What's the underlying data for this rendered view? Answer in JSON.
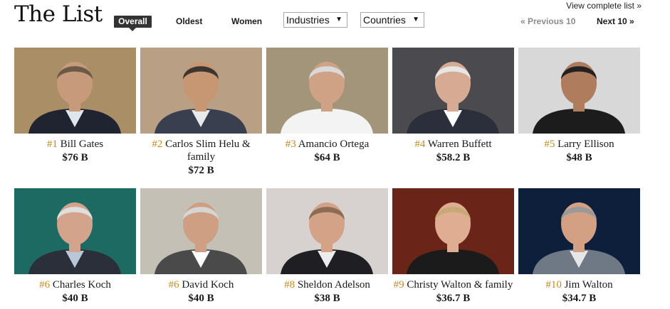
{
  "page": {
    "title": "The List",
    "view_complete": "View complete list »",
    "prev": "« Previous 10",
    "next": "Next 10 »"
  },
  "tabs": {
    "overall": "Overall",
    "oldest": "Oldest",
    "women": "Women"
  },
  "filters": {
    "industries": "Industries",
    "countries": "Countries"
  },
  "people": [
    {
      "rank": "#1",
      "name": "Bill Gates",
      "worth": "$76 B",
      "colors": {
        "bg": "#a98e66",
        "suit": "#1f2430",
        "skin": "#c89a7c",
        "hair": "#6b5a48",
        "shirt": "#dfe6ee"
      }
    },
    {
      "rank": "#2",
      "name": "Carlos Slim Helu & family",
      "worth": "$72 B",
      "colors": {
        "bg": "#b9a084",
        "suit": "#3a3f4f",
        "skin": "#c79774",
        "hair": "#3c3530",
        "shirt": "#e9e9ec"
      }
    },
    {
      "rank": "#3",
      "name": "Amancio Ortega",
      "worth": "$64 B",
      "colors": {
        "bg": "#a3957a",
        "suit": "#f3f3f3",
        "skin": "#cfa286",
        "hair": "#d9d9d9",
        "shirt": "#f3f3f3"
      }
    },
    {
      "rank": "#4",
      "name": "Warren Buffett",
      "worth": "$58.2 B",
      "colors": {
        "bg": "#4b4b4f",
        "suit": "#2a2f3b",
        "skin": "#d7aa93",
        "hair": "#e6e6e6",
        "shirt": "#ffffff"
      }
    },
    {
      "rank": "#5",
      "name": "Larry Ellison",
      "worth": "$48 B",
      "colors": {
        "bg": "#d8d8d8",
        "suit": "#1c1c1c",
        "skin": "#b07c5e",
        "hair": "#222222",
        "shirt": "#1c1c1c"
      }
    },
    {
      "rank": "#6",
      "name": "Charles Koch",
      "worth": "$40 B",
      "colors": {
        "bg": "#1d6a63",
        "suit": "#2b2f39",
        "skin": "#d3a38c",
        "hair": "#dedede",
        "shirt": "#b8c8d8"
      }
    },
    {
      "rank": "#6",
      "name": "David Koch",
      "worth": "$40 B",
      "colors": {
        "bg": "#c4c0b6",
        "suit": "#4a4a4a",
        "skin": "#cf9f83",
        "hair": "#d5d5d5",
        "shirt": "#ffffff"
      }
    },
    {
      "rank": "#8",
      "name": "Sheldon Adelson",
      "worth": "$38 B",
      "colors": {
        "bg": "#d7d2cf",
        "suit": "#1f1f23",
        "skin": "#d4a287",
        "hair": "#8b6c55",
        "shirt": "#ececec"
      }
    },
    {
      "rank": "#9",
      "name": "Christy Walton & family",
      "worth": "$36.7 B",
      "colors": {
        "bg": "#6b2418",
        "suit": "#1b1b1b",
        "skin": "#dfae92",
        "hair": "#c9a877",
        "shirt": "#1b1b1b"
      }
    },
    {
      "rank": "#10",
      "name": "Jim Walton",
      "worth": "$34.7 B",
      "colors": {
        "bg": "#0d1f3a",
        "suit": "#6f7885",
        "skin": "#d3a084",
        "hair": "#9a9a9a",
        "shirt": "#e6e6e6"
      }
    }
  ]
}
